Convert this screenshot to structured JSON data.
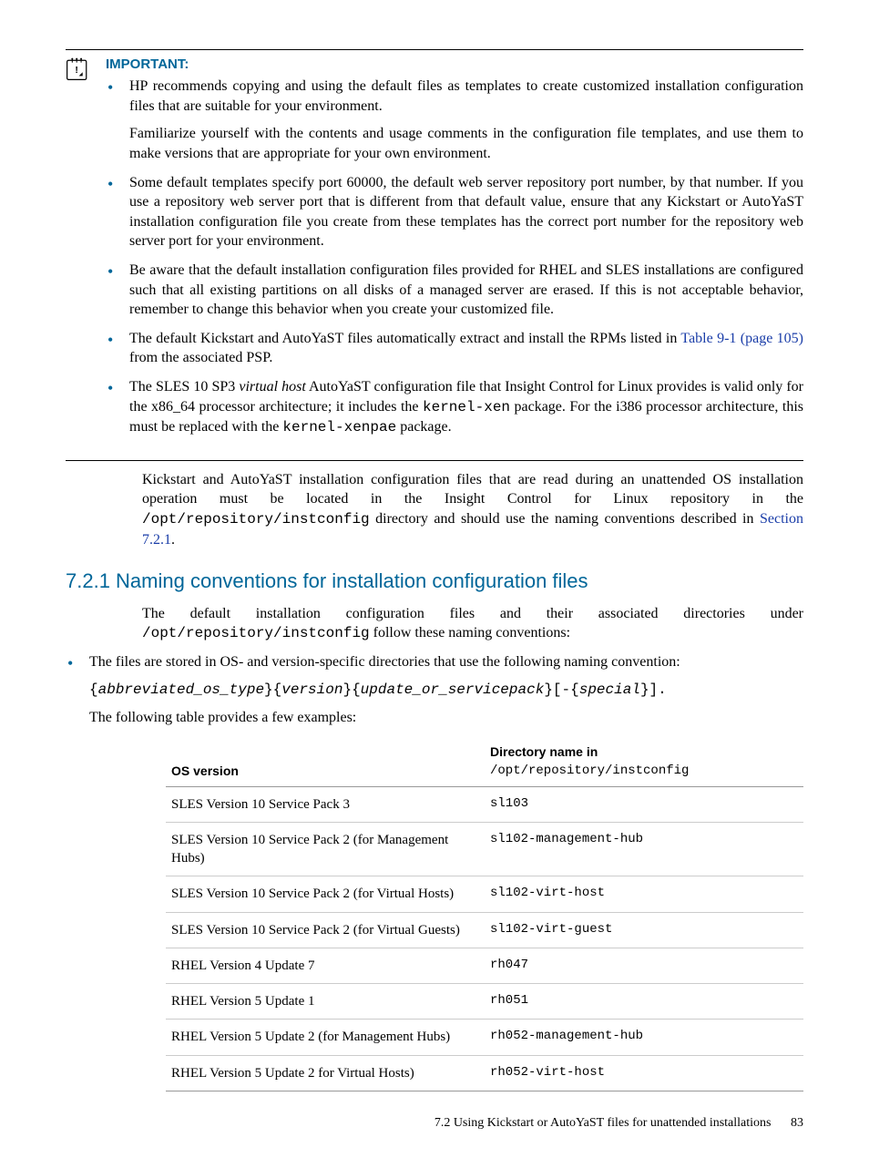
{
  "important": {
    "label": "IMPORTANT:",
    "bullets": [
      {
        "paras": [
          "HP recommends copying and using the default files as templates to create customized installation configuration files that are suitable for your environment.",
          "Familiarize yourself with the contents and usage comments in the configuration file templates, and use them to make versions that are appropriate for your own environment."
        ]
      },
      {
        "paras": [
          "Some default templates specify port 60000, the default web server repository port number, by that number. If you use a repository web server port that is different from that default value, ensure that any Kickstart or AutoYaST installation configuration file you create from these templates has the correct port number for the repository web server port for your environment."
        ]
      },
      {
        "paras": [
          "Be aware that the default installation configuration files provided for RHEL and SLES installations are configured such that all existing partitions on all disks of a managed server are erased. If this is not acceptable behavior, remember to change this behavior when you create your customized file."
        ]
      }
    ],
    "bullet4": {
      "pre": "The default Kickstart and AutoYaST files automatically extract and install the RPMs listed in ",
      "link": "Table 9-1 (page 105)",
      "post": " from the associated PSP."
    },
    "bullet5": {
      "a": "The SLES 10 SP3 ",
      "b_ital": "virtual host",
      "c": " AutoYaST configuration file that Insight Control for Linux provides is valid only for the x86_64 processor architecture; it includes the ",
      "d_mono": "kernel-xen",
      "e": " package. For the i386 processor architecture, this must be replaced with the ",
      "f_mono": "kernel-xenpae",
      "g": " package."
    }
  },
  "body_para": {
    "a": "Kickstart and AutoYaST installation configuration files that are read during an unattended OS installation operation must be located in the Insight Control for Linux repository in the ",
    "b_mono": "/opt/repository/instconfig",
    "c": " directory and should use the naming conventions described in ",
    "d_link": "Section 7.2.1",
    "e": "."
  },
  "h721": "7.2.1 Naming conventions for installation configuration files",
  "intro721": {
    "a": "The default installation configuration files and their associated directories under ",
    "b_mono": "/opt/repository/instconfig",
    "c": " follow these naming conventions:"
  },
  "naming_bullet": "The files are stored in OS- and version-specific directories that use the following naming convention:",
  "pattern": {
    "a": "{",
    "b": "abbreviated_os_type",
    "c": "}{",
    "d": "version",
    "e": "}{",
    "f": "update_or_servicepack",
    "g": "}[-{",
    "h": "special",
    "i": "}]."
  },
  "examples_lead": "The following table provides a few examples:",
  "table": {
    "h1": "OS version",
    "h2a": "Directory name in ",
    "h2b": "/opt/repository/instconfig",
    "rows": [
      {
        "os": "SLES Version 10 Service Pack 3",
        "dir": "sl103"
      },
      {
        "os": "SLES Version 10 Service Pack 2 (for Management Hubs)",
        "dir": "sl102-management-hub"
      },
      {
        "os": "SLES Version 10 Service Pack 2 (for Virtual Hosts)",
        "dir": "sl102-virt-host"
      },
      {
        "os": "SLES Version 10 Service Pack 2 (for Virtual Guests)",
        "dir": "sl102-virt-guest"
      },
      {
        "os": "RHEL Version 4 Update 7",
        "dir": "rh047"
      },
      {
        "os": "RHEL Version 5 Update 1",
        "dir": "rh051"
      },
      {
        "os": "RHEL Version 5 Update 2 (for Management Hubs)",
        "dir": "rh052-management-hub"
      },
      {
        "os": "RHEL Version 5 Update 2 for Virtual Hosts)",
        "dir": "rh052-virt-host"
      }
    ]
  },
  "footer": {
    "text": "7.2 Using Kickstart or AutoYaST files for unattended installations",
    "page": "83"
  }
}
